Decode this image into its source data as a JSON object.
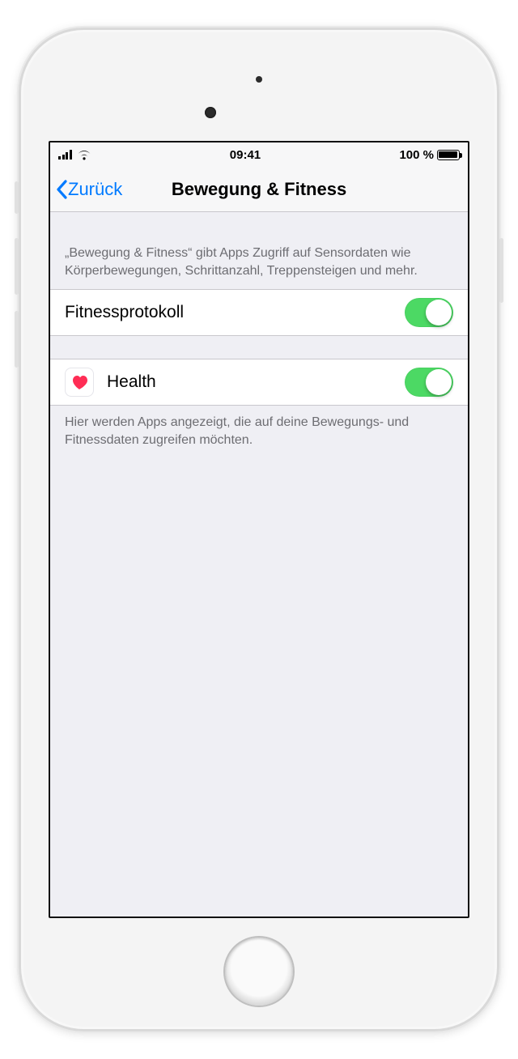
{
  "status": {
    "time": "09:41",
    "battery_pct": "100 %"
  },
  "nav": {
    "back_label": "Zurück",
    "title": "Bewegung & Fitness"
  },
  "section1": {
    "header": "„Bewegung & Fitness“ gibt Apps Zugriff auf Sensordaten wie Körperbewegungen, Schrittanzahl, Treppensteigen und mehr.",
    "row_label": "Fitnessprotokoll",
    "toggle_on": true
  },
  "section2": {
    "rows": [
      {
        "icon": "health-heart",
        "label": "Health",
        "toggle_on": true
      }
    ],
    "footer": "Hier werden Apps angezeigt, die auf deine Bewegungs- und Fitnessdaten zugreifen möchten."
  }
}
